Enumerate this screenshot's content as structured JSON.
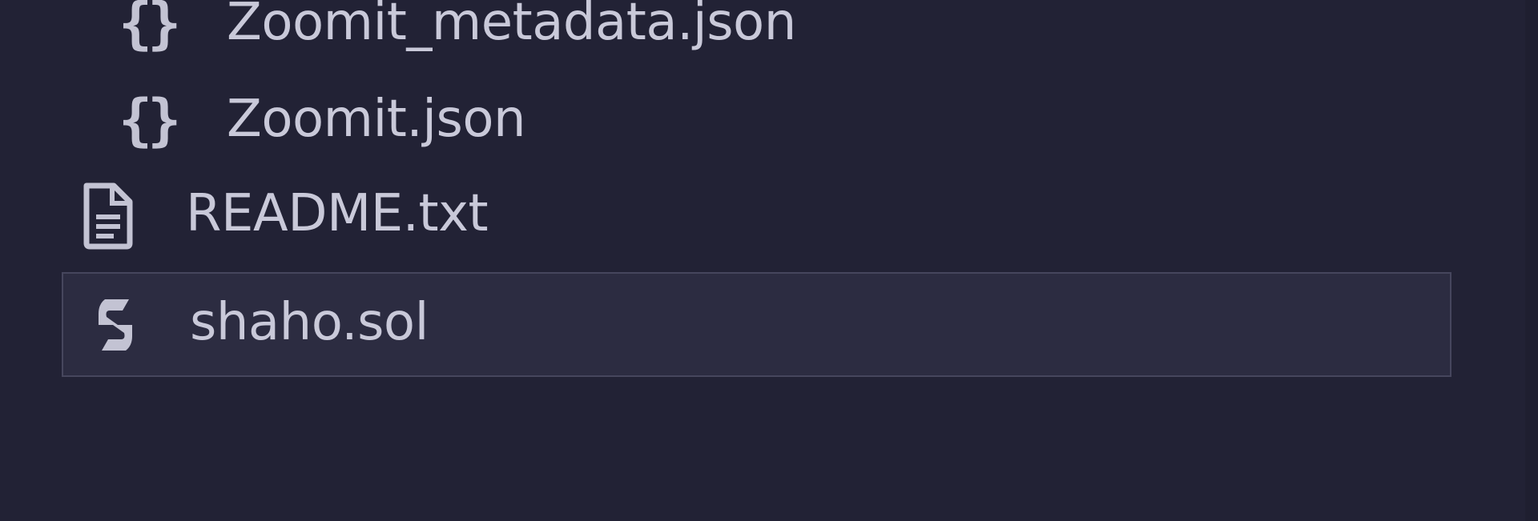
{
  "colors": {
    "background": "#222235",
    "selected_background": "#2c2c41",
    "selected_border": "#46465d",
    "text": "#c9c9d9",
    "icon": "#c3c3d3"
  },
  "files": [
    {
      "label": "Zoomit_metadata.json",
      "icon": "json-braces-icon",
      "glyph": "{}"
    },
    {
      "label": "Zoomit.json",
      "icon": "json-braces-icon",
      "glyph": "{}"
    },
    {
      "label": "README.txt",
      "icon": "text-file-icon"
    },
    {
      "label": "shaho.sol",
      "icon": "solidity-icon",
      "selected": true
    }
  ]
}
